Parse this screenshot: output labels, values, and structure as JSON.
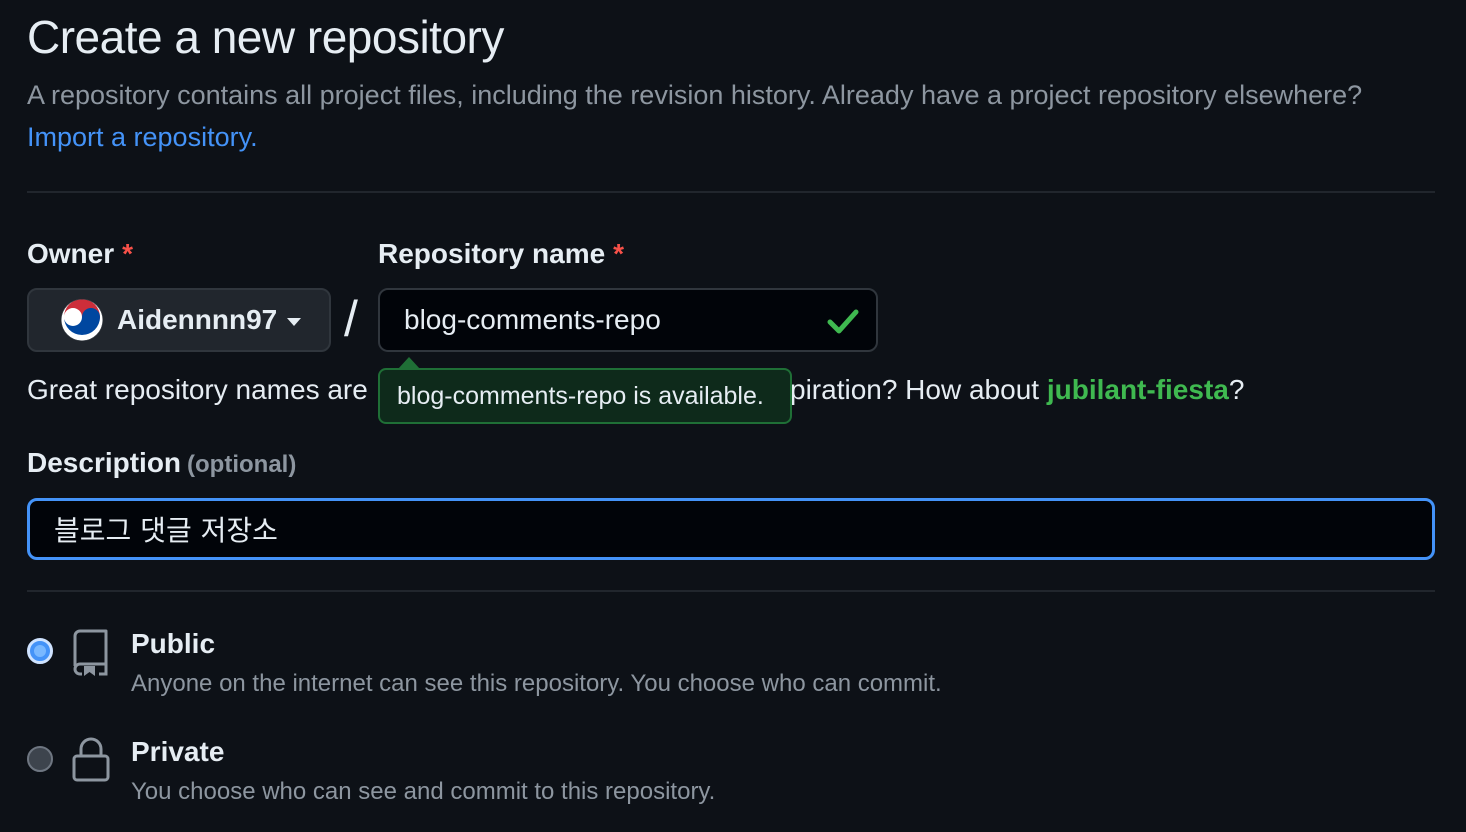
{
  "page": {
    "title": "Create a new repository",
    "subtitle": "A repository contains all project files, including the revision history. Already have a project repository elsewhere?",
    "import_link": "Import a repository."
  },
  "owner": {
    "label": "Owner",
    "required_mark": "*",
    "value": "Aidennnn97",
    "avatar_icon": "korea-flag-avatar"
  },
  "separator": "/",
  "repo_name": {
    "label": "Repository name",
    "required_mark": "*",
    "value": "blog-comments-repo",
    "status_icon": "check-icon",
    "availability_tooltip": "blog-comments-repo is available."
  },
  "name_hint": {
    "prefix": "Great repository names are",
    "suffix_before": "piration? How about",
    "suggestion": "jubilant-fiesta",
    "suffix_after": "?"
  },
  "description": {
    "label": "Description",
    "optional_text": "(optional)",
    "value": "블로그 댓글 저장소"
  },
  "visibility": [
    {
      "title": "Public",
      "description": "Anyone on the internet can see this repository. You choose who can commit.",
      "selected": true,
      "icon": "repo-icon"
    },
    {
      "title": "Private",
      "description": "You choose who can see and commit to this repository.",
      "selected": false,
      "icon": "lock-icon"
    }
  ],
  "colors": {
    "background": "#0d1117",
    "accent": "#4493f8",
    "success": "#3fb950",
    "danger": "#f85149",
    "muted_text": "#8d96a0"
  }
}
